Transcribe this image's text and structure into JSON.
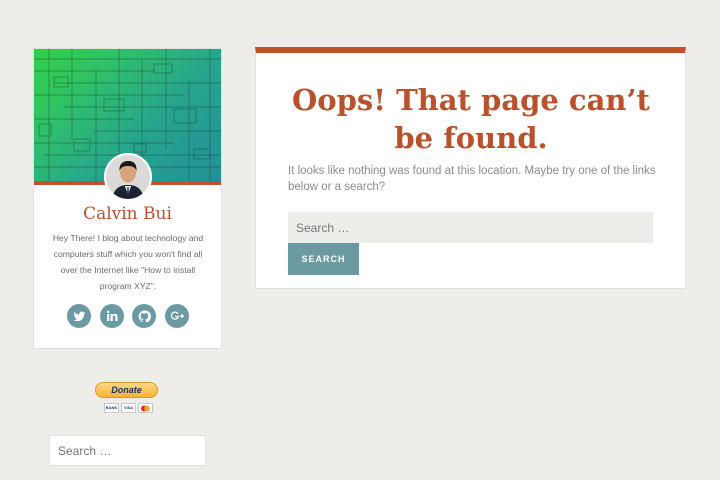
{
  "profile": {
    "name": "Calvin Bui",
    "bio": "Hey There! I blog about technology and computers stuff which you won't find all over the Internet like \"How to install program XYZ\".",
    "social": [
      {
        "icon": "twitter-icon"
      },
      {
        "icon": "linkedin-icon"
      },
      {
        "icon": "github-icon"
      },
      {
        "icon": "google-plus-icon"
      }
    ]
  },
  "donate": {
    "label": "Donate",
    "cards": [
      "BANK",
      "VISA",
      "MC"
    ]
  },
  "sidebar_search": {
    "placeholder": "Search …"
  },
  "main": {
    "title": "Oops! That page can’t be found.",
    "message": "It looks like nothing was found at this location. Maybe try one of the links below or a search?",
    "search_placeholder": "Search …",
    "search_button": "SEARCH"
  },
  "colors": {
    "accent": "#c0522d",
    "button": "#6b9aa2",
    "background": "#eeedea"
  }
}
